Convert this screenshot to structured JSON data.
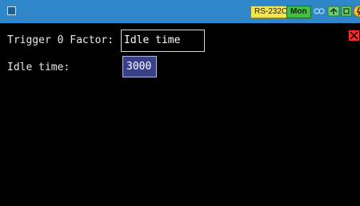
{
  "titlebar": {
    "menu_icon": "menu-square-icon",
    "status": {
      "interface_badge": "RS-232C",
      "mode_badge": "Mon",
      "icons": [
        "link-icon",
        "lan-icon",
        "card-icon",
        "power-icon"
      ]
    }
  },
  "form": {
    "factor": {
      "label": "Trigger 0 Factor:",
      "value": "Idle time"
    },
    "idle_time": {
      "label": "Idle time:",
      "value": "3000"
    }
  },
  "colors": {
    "titlebar": "#2f86c8",
    "background": "#000000",
    "rs_badge": "#f3e44d",
    "mon_badge": "#40c040",
    "close_button": "#ff2a2a",
    "selected_field": "#3a3f8a"
  },
  "close_icon": "close-icon"
}
